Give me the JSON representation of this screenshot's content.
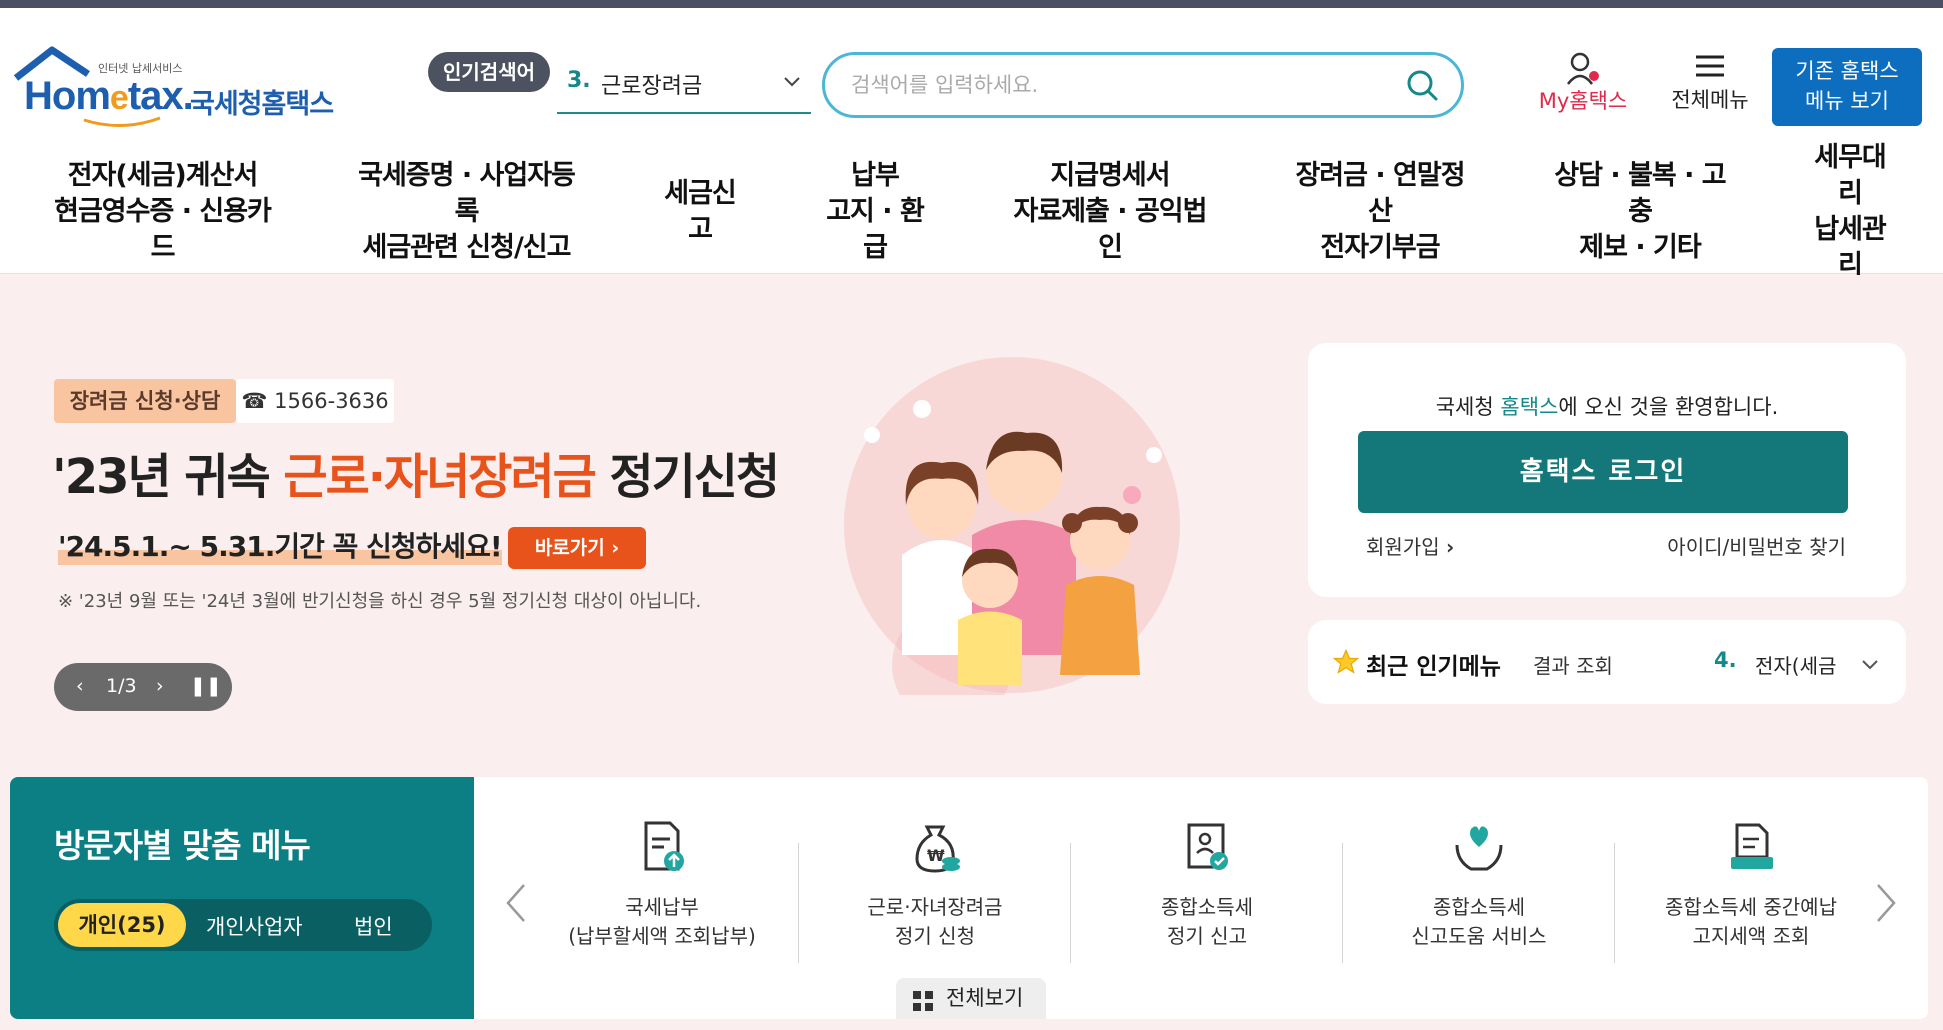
{
  "header": {
    "logo_small": "인터넷 납세서비스",
    "logo_en_1": "Hom",
    "logo_en_e": "e",
    "logo_en_2": "tax.",
    "logo_ko": "국세청홈택스",
    "popular_badge": "인기검색어",
    "popular_num": "3.",
    "popular_term": "근로장려금",
    "search_placeholder": "검색어를 입력하세요.",
    "my_hometax": "My홈택스",
    "all_menu": "전체메뉴",
    "old_menu_1": "기존 홈택스",
    "old_menu_2": "메뉴 보기"
  },
  "gnb": [
    {
      "l1": "전자(세금)계산서",
      "l2": "현금영수증 · 신용카",
      "l3": "드"
    },
    {
      "l1": "국세증명 · 사업자등",
      "l2": "록",
      "l3": "세금관련 신청/신고"
    },
    {
      "l1": "세금신",
      "l2": "고",
      "l3": ""
    },
    {
      "l1": "납부",
      "l2": "고지 · 환",
      "l3": "급"
    },
    {
      "l1": "지급명세서",
      "l2": "자료제출 · 공익법",
      "l3": "인"
    },
    {
      "l1": "장려금 · 연말정",
      "l2": "산",
      "l3": "전자기부금"
    },
    {
      "l1": "상담 · 불복 · 고",
      "l2": "충",
      "l3": "제보 · 기타"
    },
    {
      "l1": "세무대",
      "l2": "리",
      "l3": "납세관",
      "l4": "리"
    }
  ],
  "hero": {
    "tag1": "장려금 신청·상담",
    "tag2": "☎ 1566-3636",
    "title_pre": "'23년 귀속 ",
    "title_hl": "근로·자녀장려금",
    "title_post": " 정기신청",
    "sub": "'24.5.1.~ 5.31.기간 꼭 신청하세요!",
    "go_button": "바로가기 ›",
    "note": "※ '23년 9월 또는 '24년 3월에 반기신청을 하신 경우 5월 정기신청 대상이 아닙니다.",
    "slide_counter": "1/3"
  },
  "login": {
    "welcome_pre": "국세청 ",
    "welcome_hl": "홈택스",
    "welcome_post": "에 오신 것을 환영합니다.",
    "login_button": "홈택스 로그인",
    "join": "회원가입",
    "find": "아이디/비밀번호 찾기"
  },
  "popular_menu": {
    "title": "최근 인기메뉴",
    "result": "결과 조회",
    "num": "4.",
    "item": "전자(세금"
  },
  "visitor": {
    "title": "방문자별 맞춤 메뉴",
    "tabs": [
      "개인(25)",
      "개인사업자",
      "법인"
    ]
  },
  "quick": [
    {
      "l1": "국세납부",
      "l2": "(납부할세액 조회납부)"
    },
    {
      "l1": "근로·자녀장려금",
      "l2": "정기 신청"
    },
    {
      "l1": "종합소득세",
      "l2": "정기 신고"
    },
    {
      "l1": "종합소득세",
      "l2": "신고도움 서비스"
    },
    {
      "l1": "종합소득세 중간예납",
      "l2": "고지세액 조회"
    }
  ],
  "view_all": "전체보기",
  "colors": {
    "teal": "#14777a",
    "orange": "#e8531b",
    "blue": "#0d6ebf",
    "pink": "#e02a4b"
  }
}
